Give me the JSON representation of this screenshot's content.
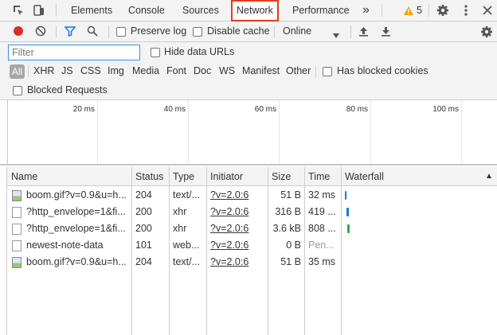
{
  "tabs": {
    "items": [
      {
        "label": "Elements",
        "active": false
      },
      {
        "label": "Console",
        "active": false
      },
      {
        "label": "Sources",
        "active": false
      },
      {
        "label": "Network",
        "active": true
      },
      {
        "label": "Performance",
        "active": false
      }
    ],
    "more_label": "»",
    "warning_count": "5",
    "warning_color": "#f0a500",
    "highlight_color": "#e53a1f"
  },
  "toolbar": {
    "preserve_log_label": "Preserve log",
    "disable_cache_label": "Disable cache",
    "throttle_value": "Online",
    "record_color": "#d93025",
    "filter_icon_color": "#1a73e8"
  },
  "filters": {
    "placeholder": "Filter",
    "hide_data_urls_label": "Hide data URLs",
    "types": [
      "All",
      "XHR",
      "JS",
      "CSS",
      "Img",
      "Media",
      "Font",
      "Doc",
      "WS",
      "Manifest",
      "Other"
    ],
    "has_blocked_cookies_label": "Has blocked cookies",
    "blocked_requests_label": "Blocked Requests"
  },
  "overview": {
    "ticks": [
      "20 ms",
      "40 ms",
      "60 ms",
      "80 ms",
      "100 ms"
    ]
  },
  "table": {
    "columns": {
      "name": "Name",
      "status": "Status",
      "type": "Type",
      "initiator": "Initiator",
      "size": "Size",
      "time": "Time",
      "waterfall": "Waterfall",
      "sort_indicator": "▲"
    },
    "rows": [
      {
        "name": "boom.gif?v=0.9&u=h...",
        "status": "204",
        "type": "text/...",
        "initiator": "?v=2.0:6",
        "size": "51 B",
        "time": "32 ms",
        "icon": "image-icon",
        "time_muted": false,
        "wf_color": "#1a73e8"
      },
      {
        "name": "?http_envelope=1&fi...",
        "status": "200",
        "type": "xhr",
        "initiator": "?v=2.0:6",
        "size": "316 B",
        "time": "419 ...",
        "icon": "document-icon",
        "time_muted": false,
        "wf_color": "#1a73e8"
      },
      {
        "name": "?http_envelope=1&fi...",
        "status": "200",
        "type": "xhr",
        "initiator": "?v=2.0:6",
        "size": "3.6 kB",
        "time": "808 ...",
        "icon": "document-icon",
        "time_muted": false,
        "wf_color": "#34a853"
      },
      {
        "name": "newest-note-data",
        "status": "101",
        "type": "web...",
        "initiator": "?v=2.0:6",
        "size": "0 B",
        "time": "Pen...",
        "icon": "document-icon",
        "time_muted": true,
        "wf_color": ""
      },
      {
        "name": "boom.gif?v=0.9&u=h...",
        "status": "204",
        "type": "text/...",
        "initiator": "?v=2.0:6",
        "size": "51 B",
        "time": "35 ms",
        "icon": "image-icon",
        "time_muted": false,
        "wf_color": ""
      }
    ]
  }
}
